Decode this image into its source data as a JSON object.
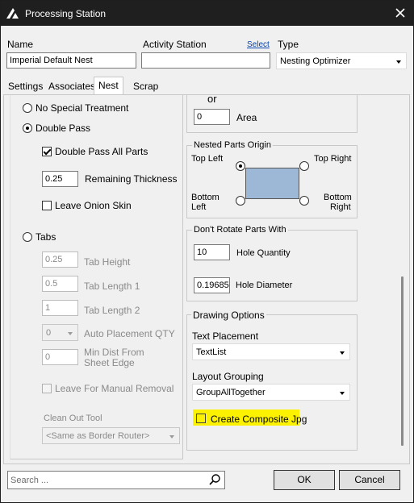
{
  "window": {
    "title": "Processing Station",
    "app_icon": "triangle-logo-icon",
    "close_icon": "close-icon"
  },
  "header": {
    "name_label": "Name",
    "name_value": "Imperial Default Nest",
    "activity_label": "Activity Station",
    "activity_value": "",
    "select_link": "Select",
    "type_label": "Type",
    "type_value": "Nesting Optimizer"
  },
  "tabs": [
    "Settings",
    "Associates",
    "Nest",
    "Scrap"
  ],
  "active_tab": "Nest",
  "left": {
    "no_special": "No Special Treatment",
    "double_pass": "Double Pass",
    "double_pass_all": "Double Pass All Parts",
    "remaining_value": "0.25",
    "remaining_label": "Remaining Thickness",
    "leave_onion": "Leave Onion Skin",
    "tabs": "Tabs",
    "tab_height_value": "0.25",
    "tab_height_label": "Tab Height",
    "tab_length1_value": "0.5",
    "tab_length1_label": "Tab Length 1",
    "tab_length2_value": "1",
    "tab_length2_label": "Tab Length 2",
    "auto_qty_value": "0",
    "auto_qty_label": "Auto Placement QTY",
    "min_dist_value": "0",
    "min_dist_label_1": "Min Dist From",
    "min_dist_label_2": "Sheet Edge",
    "leave_manual": "Leave For Manual Removal",
    "clean_out_label": "Clean Out Tool",
    "clean_out_value": "<Same as Border Router>"
  },
  "right": {
    "or_label": "or",
    "area_value": "0",
    "area_label": "Area",
    "origin_title": "Nested Parts Origin",
    "top_left": "Top Left",
    "top_right": "Top Right",
    "bottom_left_1": "Bottom",
    "bottom_left_2": "Left",
    "bottom_right_1": "Bottom",
    "bottom_right_2": "Right",
    "rotate_title": "Don't Rotate Parts With",
    "hole_qty_value": "10",
    "hole_qty_label": "Hole Quantity",
    "hole_dia_value": "0.19685",
    "hole_dia_label": "Hole Diameter",
    "drawing_title": "Drawing Options",
    "text_placement_label": "Text Placement",
    "text_placement_value": "TextList",
    "layout_grouping_label": "Layout Grouping",
    "layout_grouping_value": "GroupAllTogether",
    "composite_label": "Create Composite Jpg"
  },
  "footer": {
    "search_placeholder": "Search ...",
    "search_icon": "search-icon",
    "ok": "OK",
    "cancel": "Cancel"
  },
  "colors": {
    "highlight": "#fcf200",
    "origin_rect": "#9db8d6",
    "titlebar": "#1f1f1f",
    "link": "#0645ad"
  }
}
